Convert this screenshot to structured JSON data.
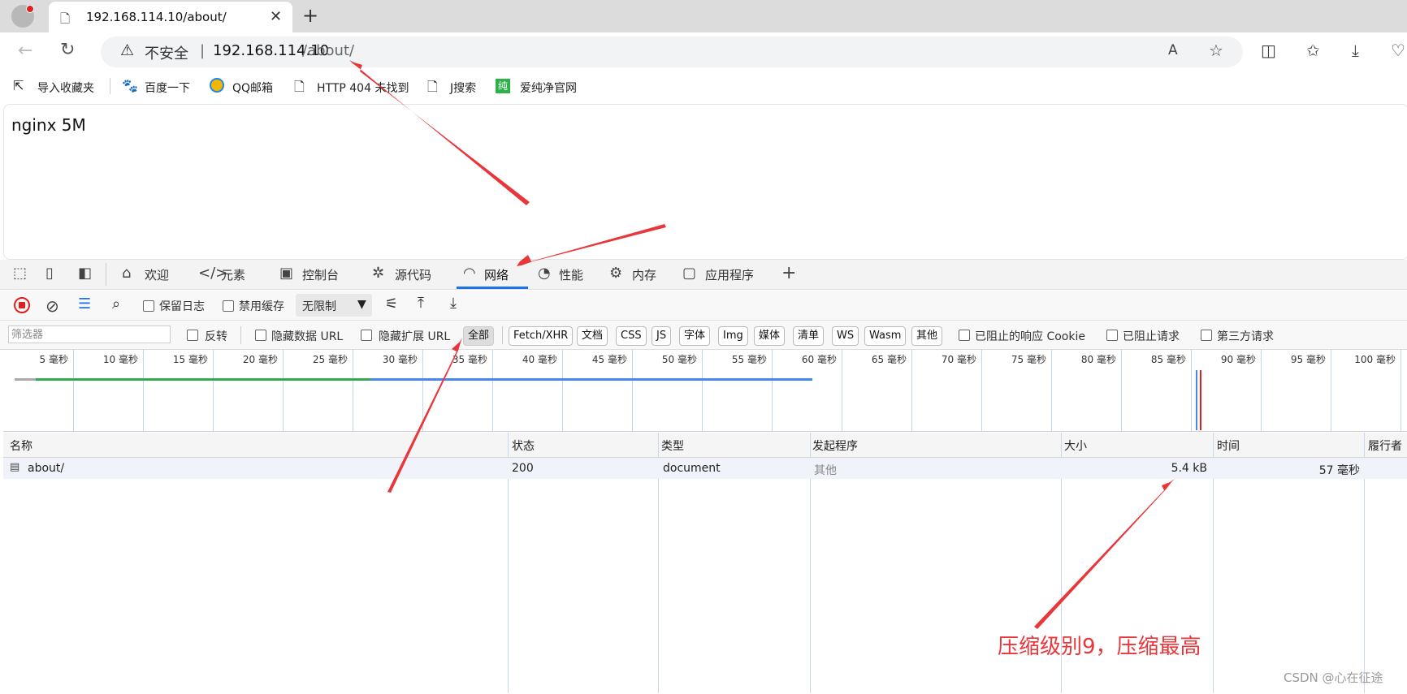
{
  "browser": {
    "tab_title": "192.168.114.10/about/",
    "close_glyph": "✕",
    "new_tab_glyph": "+",
    "security_text": "不安全",
    "separator": "|",
    "url_host": "192.168.114.10",
    "url_path": "/about/"
  },
  "bookmarks": [
    {
      "label": "导入收藏夹",
      "icon": "import-icon"
    },
    {
      "label": "百度一下",
      "icon": "baidu-icon"
    },
    {
      "label": "QQ邮箱",
      "icon": "qqmail-icon"
    },
    {
      "label": "HTTP 404 未找到",
      "icon": "page-icon"
    },
    {
      "label": "J搜索",
      "icon": "page-icon"
    },
    {
      "label": "爱纯净官网",
      "icon": "chun-icon",
      "icon_text": "纯"
    }
  ],
  "page": {
    "heading": "nginx 5M"
  },
  "devtools": {
    "tabs": [
      "欢迎",
      "元素",
      "控制台",
      "源代码",
      "网络",
      "性能",
      "内存",
      "应用程序"
    ],
    "active_tab": "网络",
    "add_tab_glyph": "+",
    "network": {
      "preserve_log": "保留日志",
      "disable_cache": "禁用缓存",
      "throttling": "无限制"
    },
    "filter": {
      "placeholder": "筛选器",
      "invert": "反转",
      "hide_data_urls": "隐藏数据 URL",
      "hide_ext_urls": "隐藏扩展 URL",
      "types": [
        "全部",
        "Fetch/XHR",
        "文档",
        "CSS",
        "JS",
        "字体",
        "Img",
        "媒体",
        "清单",
        "WS",
        "Wasm",
        "其他"
      ],
      "active_type": "全部",
      "blocked_cookies": "已阻止的响应 Cookie",
      "blocked_requests": "已阻止请求",
      "third_party": "第三方请求"
    },
    "overview_ticks": [
      "5 毫秒",
      "10 毫秒",
      "15 毫秒",
      "20 毫秒",
      "25 毫秒",
      "30 毫秒",
      "35 毫秒",
      "40 毫秒",
      "45 毫秒",
      "50 毫秒",
      "55 毫秒",
      "60 毫秒",
      "65 毫秒",
      "70 毫秒",
      "75 毫秒",
      "80 毫秒",
      "85 毫秒",
      "90 毫秒",
      "95 毫秒",
      "100 毫秒"
    ],
    "columns": [
      "名称",
      "状态",
      "类型",
      "发起程序",
      "大小",
      "时间",
      "履行者"
    ],
    "rows": [
      {
        "name": "about/",
        "status": "200",
        "type": "document",
        "initiator": "其他",
        "size": "5.4 kB",
        "time": "57 毫秒"
      }
    ]
  },
  "annotation": "压缩级别9，压缩最高",
  "watermark": "CSDN @心在征途",
  "colors": {
    "accent": "#1a73e8",
    "annotation": "#e8363a",
    "record_red": "#e02020",
    "timeline_green": "#34a853",
    "timeline_blue": "#4a86e8"
  }
}
